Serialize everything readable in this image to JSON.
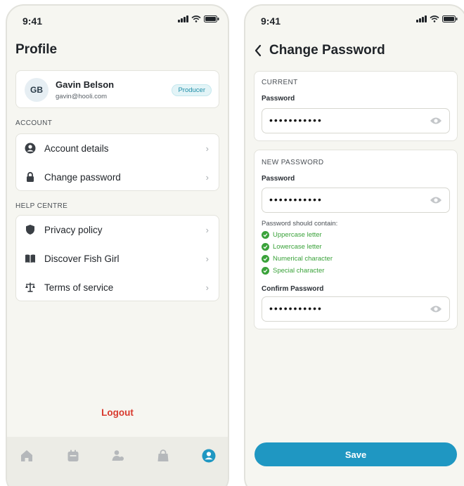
{
  "profile_screen": {
    "status_time": "9:41",
    "title": "Profile",
    "user": {
      "initials": "GB",
      "name": "Gavin Belson",
      "email": "gavin@hooli.com",
      "role": "Producer"
    },
    "account_section": {
      "label": "ACCOUNT",
      "items": [
        {
          "label": "Account details",
          "icon": "user-circle-icon"
        },
        {
          "label": "Change password",
          "icon": "lock-icon"
        }
      ]
    },
    "help_section": {
      "label": "HELP CENTRE",
      "items": [
        {
          "label": "Privacy policy",
          "icon": "shield-icon"
        },
        {
          "label": "Discover Fish Girl",
          "icon": "book-icon"
        },
        {
          "label": "Terms of service",
          "icon": "scales-icon"
        }
      ]
    },
    "logout_label": "Logout",
    "tabs": [
      "home-icon",
      "calendar-icon",
      "people-icon",
      "bag-icon",
      "profile-icon"
    ],
    "active_tab": "profile-icon"
  },
  "change_password_screen": {
    "status_time": "9:41",
    "title": "Change Password",
    "current_section": {
      "label": "CURRENT",
      "field_label": "Password",
      "value": "•••••••••••"
    },
    "new_section": {
      "label": "NEW PASSWORD",
      "field_label": "Password",
      "value": "•••••••••••",
      "hint": "Password should contain:",
      "requirements": [
        "Uppercase letter",
        "Lowercase letter",
        "Numerical character",
        "Special character"
      ],
      "confirm_label": "Confirm Password",
      "confirm_value": "•••••••••••"
    },
    "save_label": "Save"
  },
  "colors": {
    "accent": "#1f97c2",
    "logout": "#d83a2e",
    "success": "#3aa23a",
    "badge_text": "#1e8ea8",
    "background": "#f6f6f1"
  }
}
